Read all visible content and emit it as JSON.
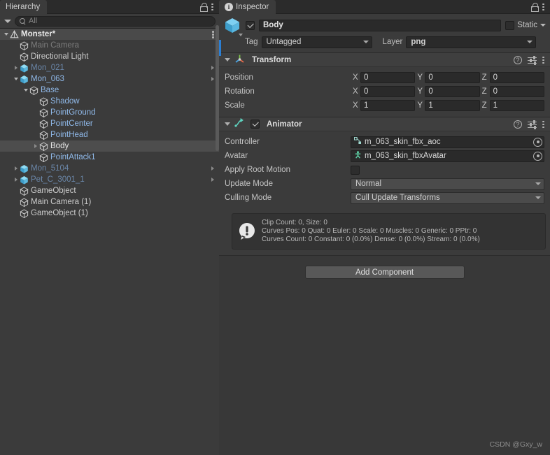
{
  "hierarchy": {
    "tab_label": "Hierarchy",
    "tab_icon": "hierarchy-icon",
    "lock_icon": "lock-icon",
    "menu_icon": "kebab-menu-icon",
    "search": {
      "value": "All",
      "placeholder": "All",
      "icon": "search-icon"
    },
    "items": [
      {
        "label": "Monster*",
        "indent": 0,
        "twisty": "down",
        "icon": "unity-prefab-icon",
        "style": "bold",
        "trailing": "kebab"
      },
      {
        "label": "Main Camera",
        "indent": 1,
        "twisty": "none",
        "icon": "gameobject-icon",
        "style": "dim",
        "trailing": "none"
      },
      {
        "label": "Directional Light",
        "indent": 1,
        "twisty": "none",
        "icon": "gameobject-icon",
        "style": "plain",
        "trailing": "none"
      },
      {
        "label": "Mon_021",
        "indent": 1,
        "twisty": "right",
        "icon": "prefab-cube-icon",
        "style": "dimblue",
        "trailing": "arrow"
      },
      {
        "label": "Mon_063",
        "indent": 1,
        "twisty": "down",
        "icon": "prefab-cube-icon",
        "style": "prefab",
        "trailing": "arrow"
      },
      {
        "label": "Base",
        "indent": 2,
        "twisty": "down",
        "icon": "gameobject-icon",
        "style": "prefab",
        "trailing": "none"
      },
      {
        "label": "Shadow",
        "indent": 3,
        "twisty": "none",
        "icon": "gameobject-icon",
        "style": "prefab",
        "trailing": "none"
      },
      {
        "label": "PointGround",
        "indent": 3,
        "twisty": "none",
        "icon": "gameobject-icon",
        "style": "prefab",
        "trailing": "none"
      },
      {
        "label": "PointCenter",
        "indent": 3,
        "twisty": "none",
        "icon": "gameobject-icon",
        "style": "prefab",
        "trailing": "none"
      },
      {
        "label": "PointHead",
        "indent": 3,
        "twisty": "none",
        "icon": "gameobject-icon",
        "style": "prefab",
        "trailing": "none"
      },
      {
        "label": "Body",
        "indent": 3,
        "twisty": "right",
        "icon": "gameobject-icon",
        "style": "white",
        "trailing": "none",
        "selected": true
      },
      {
        "label": "PointAttack1",
        "indent": 3,
        "twisty": "none",
        "icon": "gameobject-icon",
        "style": "prefab",
        "trailing": "none"
      },
      {
        "label": "Mon_5104",
        "indent": 1,
        "twisty": "right",
        "icon": "prefab-cube-icon",
        "style": "dimblue",
        "trailing": "arrow"
      },
      {
        "label": "Pet_C_3001_1",
        "indent": 1,
        "twisty": "right",
        "icon": "prefab-cube-icon",
        "style": "dimblue",
        "trailing": "arrow"
      },
      {
        "label": "GameObject",
        "indent": 1,
        "twisty": "none",
        "icon": "gameobject-icon",
        "style": "plain",
        "trailing": "none"
      },
      {
        "label": "Main Camera (1)",
        "indent": 1,
        "twisty": "none",
        "icon": "gameobject-icon",
        "style": "plain",
        "trailing": "none"
      },
      {
        "label": "GameObject (1)",
        "indent": 1,
        "twisty": "none",
        "icon": "gameobject-icon",
        "style": "plain",
        "trailing": "none"
      }
    ]
  },
  "inspector": {
    "tab_label": "Inspector",
    "tab_icon": "info-icon",
    "lock_icon": "lock-icon",
    "menu_icon": "kebab-menu-icon",
    "object": {
      "icon": "gameobject-cube-icon",
      "enabled_checkbox": "checked",
      "name": "Body",
      "static_label": "Static",
      "static_checked": false,
      "tag_label": "Tag",
      "tag_value": "Untagged",
      "layer_label": "Layer",
      "layer_value": "png"
    },
    "transform": {
      "title": "Transform",
      "icon": "transform-axis-icon",
      "help_icon": "help-icon",
      "preset_icon": "preset-sliders-icon",
      "menu_icon": "kebab-menu-icon",
      "rows": [
        {
          "label": "Position",
          "x": "0",
          "y": "0",
          "z": "0"
        },
        {
          "label": "Rotation",
          "x": "0",
          "y": "0",
          "z": "0"
        },
        {
          "label": "Scale",
          "x": "1",
          "y": "1",
          "z": "1"
        }
      ],
      "axis_labels": {
        "x": "X",
        "y": "Y",
        "z": "Z"
      }
    },
    "animator": {
      "title": "Animator",
      "icon": "animator-icon",
      "enabled_checkbox": "checked",
      "help_icon": "help-icon",
      "preset_icon": "preset-sliders-icon",
      "menu_icon": "kebab-menu-icon",
      "controller_label": "Controller",
      "controller_value": "m_063_skin_fbx_aoc",
      "controller_icon": "animator-controller-icon",
      "avatar_label": "Avatar",
      "avatar_value": "m_063_skin_fbxAvatar",
      "avatar_icon": "avatar-icon",
      "apply_root_motion_label": "Apply Root Motion",
      "apply_root_motion_checked": false,
      "update_mode_label": "Update Mode",
      "update_mode_value": "Normal",
      "culling_mode_label": "Culling Mode",
      "culling_mode_value": "Cull Update Transforms",
      "info": {
        "icon": "warning-icon",
        "line1": "Clip Count: 0, Size: 0",
        "line2": "Curves Pos: 0 Quat: 0 Euler: 0 Scale: 0 Muscles: 0 Generic: 0 PPtr: 0",
        "line3": "Curves Count: 0 Constant: 0 (0.0%) Dense: 0 (0.0%) Stream: 0 (0.0%)"
      }
    },
    "add_component_label": "Add Component"
  },
  "watermark": "CSDN @Gxy_w",
  "colors": {
    "panel_bg": "#3b3b3b",
    "window_bg": "#383838",
    "tabbar_bg": "#2b2b2b",
    "field_bg": "#2a2a2a",
    "accent_blue": "#2b7fd4",
    "prefab_blue": "#8fb8e8",
    "selected_row": "#4d4d4d",
    "button_bg": "#585858",
    "text": "#c4c4c4"
  }
}
